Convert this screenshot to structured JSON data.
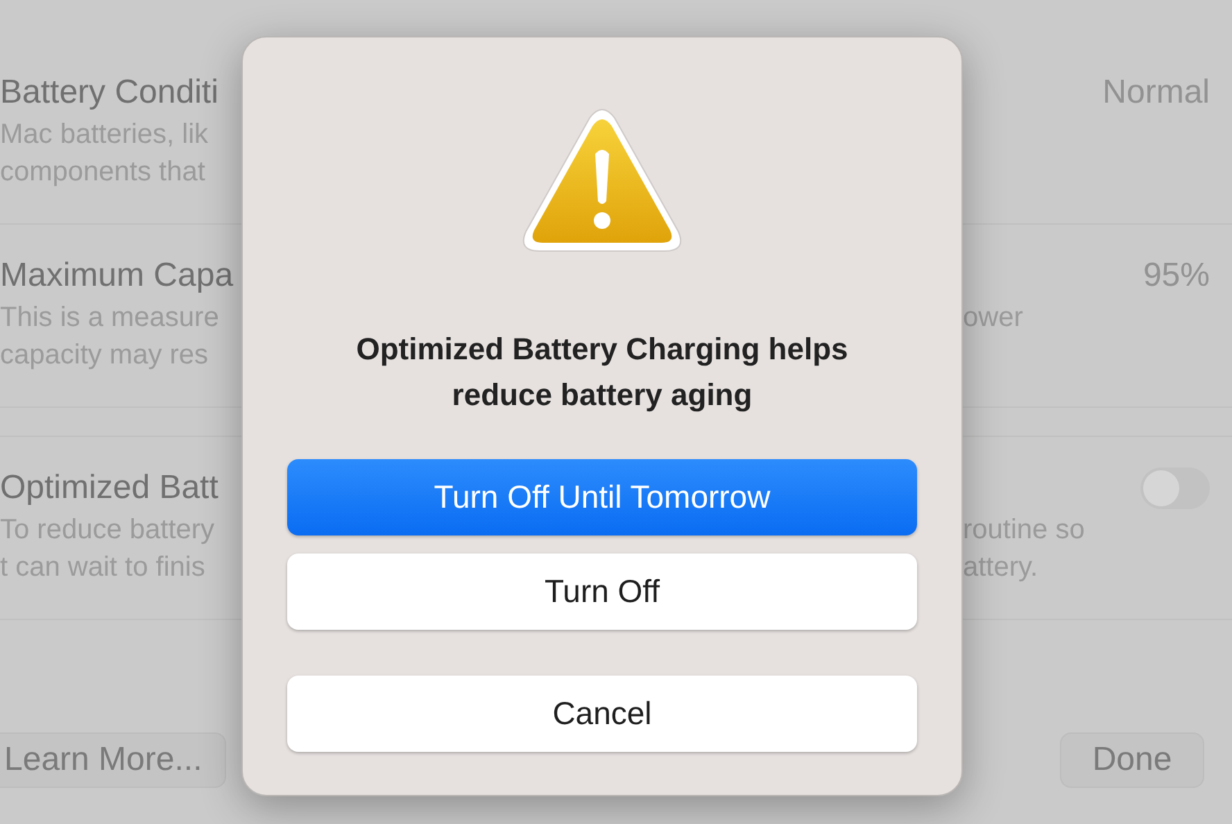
{
  "background": {
    "rows": [
      {
        "title": "Battery Conditi",
        "description": [
          "Mac batteries, lik",
          "components that"
        ],
        "value": "Normal",
        "right_description": []
      },
      {
        "title": "Maximum Capa",
        "description": [
          "This is a measure",
          "capacity may res"
        ],
        "value": "95%",
        "right_description": [
          "ower"
        ]
      },
      {
        "title": "Optimized Batt",
        "description": [
          "To reduce battery",
          "t can wait to finis"
        ],
        "toggle": {
          "on": false
        },
        "right_description": [
          "routine so",
          "attery."
        ]
      }
    ],
    "learn_more": "Learn More...",
    "done": "Done"
  },
  "dialog": {
    "title": "Optimized Battery Charging helps reduce battery aging",
    "buttons": [
      {
        "label": "Turn Off Until Tomorrow",
        "kind": "default"
      },
      {
        "label": "Turn Off",
        "kind": "normal"
      },
      {
        "label": "Cancel",
        "kind": "cancel"
      }
    ]
  }
}
